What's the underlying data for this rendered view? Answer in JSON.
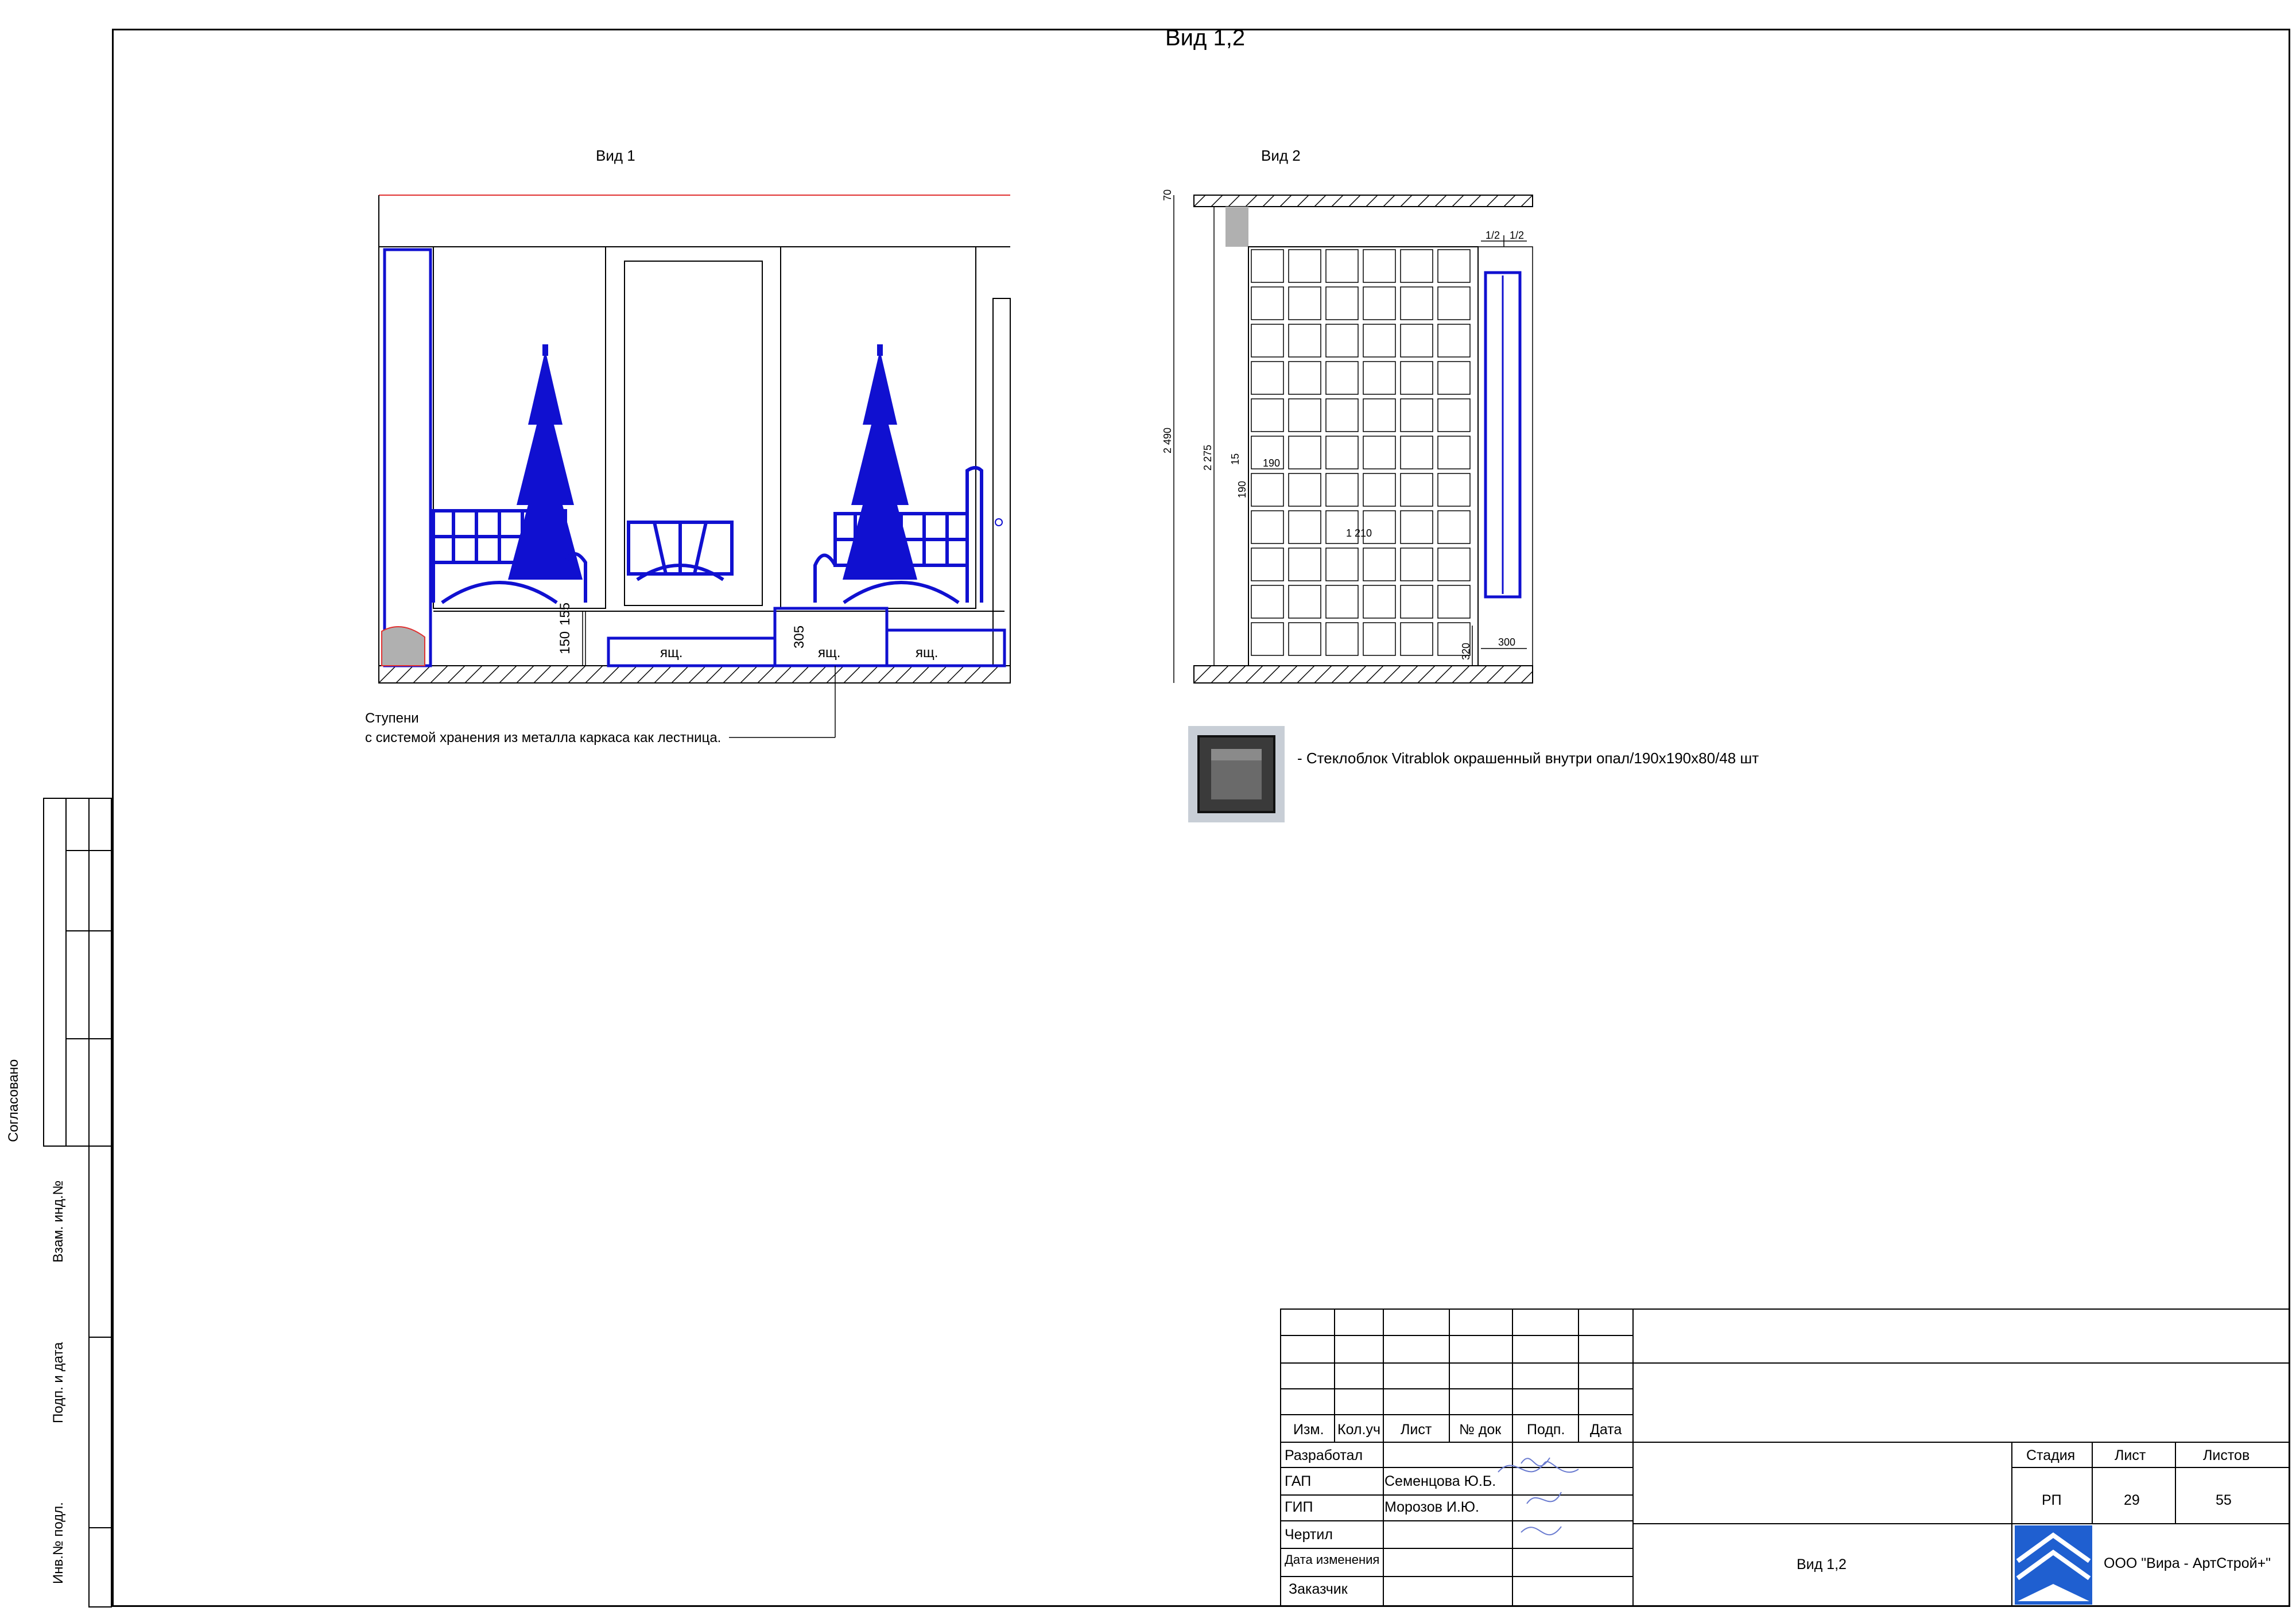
{
  "sheet": {
    "title": "Вид 1,2"
  },
  "view1": {
    "label": "Вид 1",
    "dims": [
      "150",
      "155",
      "305"
    ],
    "drawer_label": "ящ.",
    "note_line1": "Ступени",
    "note_line2": " с системой хранения из металла каркаса как лестница."
  },
  "view2": {
    "label": "Вид 2",
    "dims": {
      "top_left": "70",
      "height_total": "2 490",
      "height_wall": "2 275",
      "block_w": "190",
      "block_h": "190",
      "width": "1 210",
      "half_a": "1/2",
      "half_b": "1/2",
      "bottom_h": "320",
      "depth": "300",
      "small": "15"
    }
  },
  "legend": {
    "text": "- Стеклоблок Vitrablok окрашенный внутри опал/190х190х80/48 шт"
  },
  "side_strip": {
    "agreed": "Согласовано",
    "inv_ref": "Взам. инд.№",
    "sign_date": "Подп. и дата",
    "inv_orig": "Инв.№ подл."
  },
  "title_block": {
    "headers": [
      "Изм.",
      "Кол.уч",
      "Лист",
      "№ док",
      "Подп.",
      "Дата"
    ],
    "rows": [
      {
        "role": "Разработал",
        "name": ""
      },
      {
        "role": "ГАП",
        "name": "Семенцова Ю.Б."
      },
      {
        "role": "ГИП",
        "name": "Морозов И.Ю."
      },
      {
        "role": "Чертил",
        "name": ""
      },
      {
        "role": "Дата изменения",
        "name": ""
      },
      {
        "role": "Заказчик",
        "name": ""
      }
    ],
    "sheet_name": "Вид 1,2",
    "stage_label": "Стадия",
    "sheet_label": "Лист",
    "sheets_label": "Листов",
    "stage": "РП",
    "sheet_no": "29",
    "sheets_total": "55",
    "company": "ООО \"Вира - АртСтрой+\""
  },
  "colors": {
    "line": "#000000",
    "furniture": "#1010d0",
    "guide": "#e03030",
    "shade": "#b0b0b0"
  }
}
